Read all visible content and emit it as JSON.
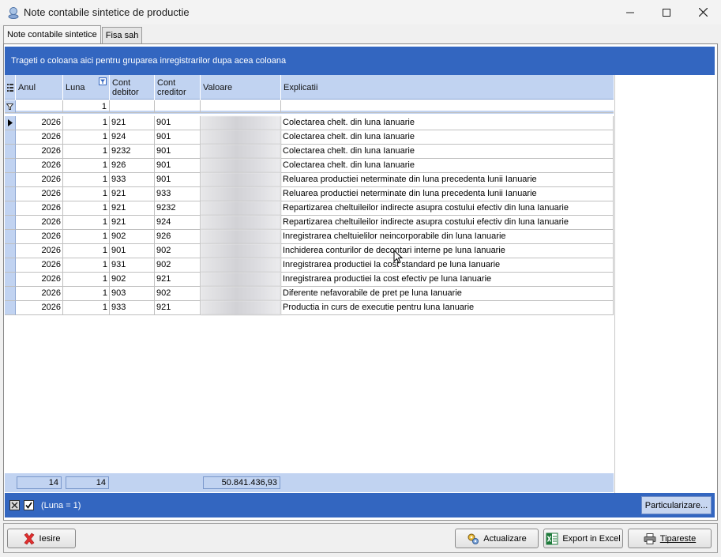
{
  "window": {
    "title": "Note contabile sintetice de productie"
  },
  "tabs": [
    {
      "label": "Note contabile sintetice",
      "active": true
    },
    {
      "label": "Fisa sah",
      "active": false
    }
  ],
  "grid": {
    "group_hint": "Trageti o coloana aici pentru gruparea inregistrarilor dupa acea coloana",
    "columns": [
      "Anul",
      "Luna",
      "Cont debitor",
      "Cont creditor",
      "Valoare",
      "Explicatii"
    ],
    "filter_luna": "1",
    "rows": [
      {
        "anul": "2026",
        "luna": "1",
        "debit": "921",
        "credit": "901",
        "explicatii": "Colectarea chelt. din luna Ianuarie"
      },
      {
        "anul": "2026",
        "luna": "1",
        "debit": "924",
        "credit": "901",
        "explicatii": "Colectarea chelt. din luna Ianuarie"
      },
      {
        "anul": "2026",
        "luna": "1",
        "debit": "9232",
        "credit": "901",
        "explicatii": "Colectarea chelt. din luna Ianuarie"
      },
      {
        "anul": "2026",
        "luna": "1",
        "debit": "926",
        "credit": "901",
        "explicatii": "Colectarea chelt. din luna Ianuarie"
      },
      {
        "anul": "2026",
        "luna": "1",
        "debit": "933",
        "credit": "901",
        "explicatii": "Reluarea productiei neterminate din luna precedenta lunii Ianuarie"
      },
      {
        "anul": "2026",
        "luna": "1",
        "debit": "921",
        "credit": "933",
        "explicatii": "Reluarea productiei neterminate din luna precedenta lunii Ianuarie"
      },
      {
        "anul": "2026",
        "luna": "1",
        "debit": "921",
        "credit": "9232",
        "explicatii": "Repartizarea cheltuileilor indirecte asupra costului efectiv din luna Ianuarie"
      },
      {
        "anul": "2026",
        "luna": "1",
        "debit": "921",
        "credit": "924",
        "explicatii": "Repartizarea cheltuileilor indirecte asupra costului efectiv din luna Ianuarie"
      },
      {
        "anul": "2026",
        "luna": "1",
        "debit": "902",
        "credit": "926",
        "explicatii": "Inregistrarea cheltuielilor neincorporabile din luna Ianuarie"
      },
      {
        "anul": "2026",
        "luna": "1",
        "debit": "901",
        "credit": "902",
        "explicatii": "Inchiderea conturilor de decontari interne pe luna Ianuarie"
      },
      {
        "anul": "2026",
        "luna": "1",
        "debit": "931",
        "credit": "902",
        "explicatii": "Inregistrarea productiei la cost standard pe luna Ianuarie"
      },
      {
        "anul": "2026",
        "luna": "1",
        "debit": "902",
        "credit": "921",
        "explicatii": "Inregistrarea productiei la cost efectiv pe luna Ianuarie"
      },
      {
        "anul": "2026",
        "luna": "1",
        "debit": "903",
        "credit": "902",
        "explicatii": "Diferente nefavorabile de pret pe luna Ianuarie"
      },
      {
        "anul": "2026",
        "luna": "1",
        "debit": "933",
        "credit": "921",
        "explicatii": "Productia in curs de executie pentru luna  Ianuarie"
      }
    ],
    "footer": {
      "anul_count": "14",
      "luna_count": "14",
      "valoare_total": "50.841.436,93"
    }
  },
  "filter_bar": {
    "text": "(Luna = 1)",
    "customize_label": "Particularizare..."
  },
  "buttons": {
    "exit": "Iesire",
    "refresh": "Actualizare",
    "export": "Export in Excel",
    "print": "Tipareste"
  }
}
